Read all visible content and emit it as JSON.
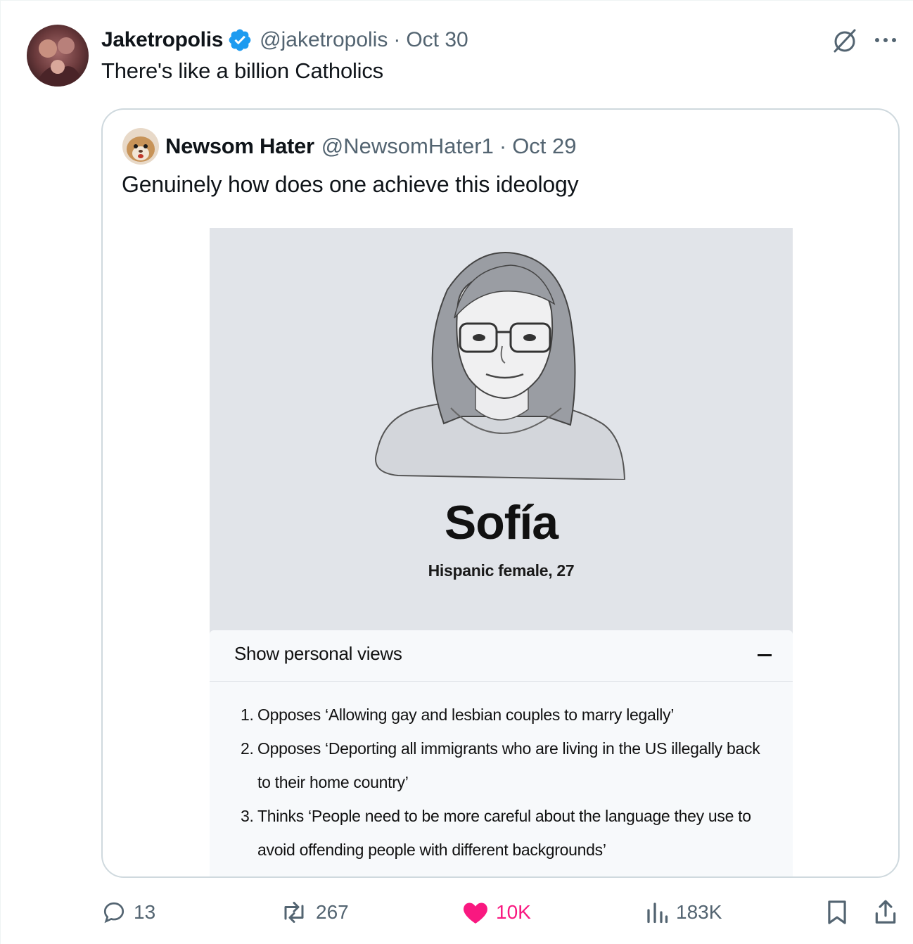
{
  "post": {
    "author_name": "Jaketropolis",
    "author_handle": "@jaketropolis",
    "separator": "·",
    "date": "Oct 30",
    "text": "There's like a billion Catholics"
  },
  "quote": {
    "author_name": "Newsom Hater",
    "author_handle": "@NewsomHater1",
    "separator": "·",
    "date": "Oct 29",
    "text": "Genuinely how does one achieve this ideology",
    "card": {
      "name": "Sofía",
      "subtitle": "Hispanic female, 27",
      "views_toggle": "Show personal views",
      "views": [
        {
          "num": "1.",
          "text": "Opposes ‘Allowing gay and lesbian couples to marry legally’"
        },
        {
          "num": "2.",
          "text": "Opposes ‘Deporting all immigrants who are living in the US illegally back to their home country’"
        },
        {
          "num": "3.",
          "text": "Thinks ‘People need to be more careful about the language they use to avoid offending people with different backgrounds’"
        }
      ]
    }
  },
  "actions": {
    "replies": "13",
    "reposts": "267",
    "likes": "10K",
    "views": "183K"
  },
  "icons": {
    "verified": "verified-badge-icon",
    "grok": "grok-icon",
    "more": "more-icon",
    "reply": "reply-icon",
    "repost": "repost-icon",
    "like": "heart-icon",
    "views": "analytics-icon",
    "bookmark": "bookmark-icon",
    "share": "share-icon"
  },
  "colors": {
    "verified": "#1d9bf0",
    "like": "#f91880",
    "muted": "#536471",
    "border": "#cfd9de",
    "card_bg": "#e1e4e9"
  }
}
